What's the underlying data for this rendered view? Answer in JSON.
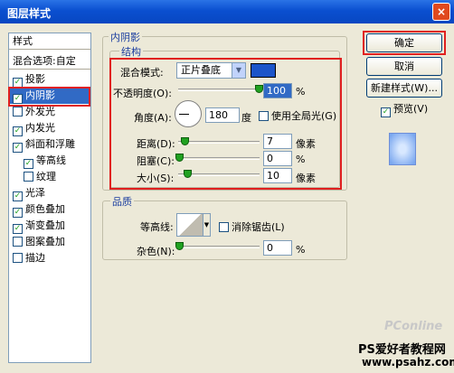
{
  "window": {
    "title": "图层样式",
    "close_glyph": "×"
  },
  "style_list": {
    "header": "样式",
    "blend_options": "混合选项:自定",
    "items": [
      {
        "label": "投影",
        "checked": true,
        "sub": false,
        "selected": false
      },
      {
        "label": "内阴影",
        "checked": true,
        "sub": false,
        "selected": true
      },
      {
        "label": "外发光",
        "checked": false,
        "sub": false,
        "selected": false
      },
      {
        "label": "内发光",
        "checked": true,
        "sub": false,
        "selected": false
      },
      {
        "label": "斜面和浮雕",
        "checked": true,
        "sub": false,
        "selected": false
      },
      {
        "label": "等高线",
        "checked": true,
        "sub": true,
        "selected": false
      },
      {
        "label": "纹理",
        "checked": false,
        "sub": true,
        "selected": false
      },
      {
        "label": "光泽",
        "checked": true,
        "sub": false,
        "selected": false
      },
      {
        "label": "颜色叠加",
        "checked": true,
        "sub": false,
        "selected": false
      },
      {
        "label": "渐变叠加",
        "checked": true,
        "sub": false,
        "selected": false
      },
      {
        "label": "图案叠加",
        "checked": false,
        "sub": false,
        "selected": false
      },
      {
        "label": "描边",
        "checked": false,
        "sub": false,
        "selected": false
      }
    ]
  },
  "inner_shadow": {
    "panel_title": "内阴影",
    "structure_title": "结构",
    "blend_mode_label": "混合模式:",
    "blend_mode_value": "正片叠底",
    "shadow_color": "#1c55c9",
    "opacity_label": "不透明度(O):",
    "opacity_value": "100",
    "opacity_unit": "%",
    "angle_label": "角度(A):",
    "angle_value": "180",
    "angle_unit": "度",
    "global_light_label": "使用全局光(G)",
    "global_light_checked": false,
    "distance_label": "距离(D):",
    "distance_value": "7",
    "distance_unit": "像素",
    "choke_label": "阻塞(C):",
    "choke_value": "0",
    "choke_unit": "%",
    "size_label": "大小(S):",
    "size_value": "10",
    "size_unit": "像素",
    "quality_title": "品质",
    "contour_label": "等高线:",
    "antialias_label": "消除锯齿(L)",
    "antialias_checked": false,
    "noise_label": "杂色(N):",
    "noise_value": "0",
    "noise_unit": "%"
  },
  "buttons": {
    "ok": "确定",
    "cancel": "取消",
    "new_style": "新建样式(W)...",
    "preview_label": "预览(V)",
    "preview_checked": true
  },
  "watermark": {
    "logo": "PConline",
    "line1": "PS爱好者教程网",
    "line2": "www.psahz.com"
  },
  "colors": {
    "accent_red": "#e02020",
    "selection_blue": "#316ac5",
    "title_blue": "#0a4fd0"
  }
}
